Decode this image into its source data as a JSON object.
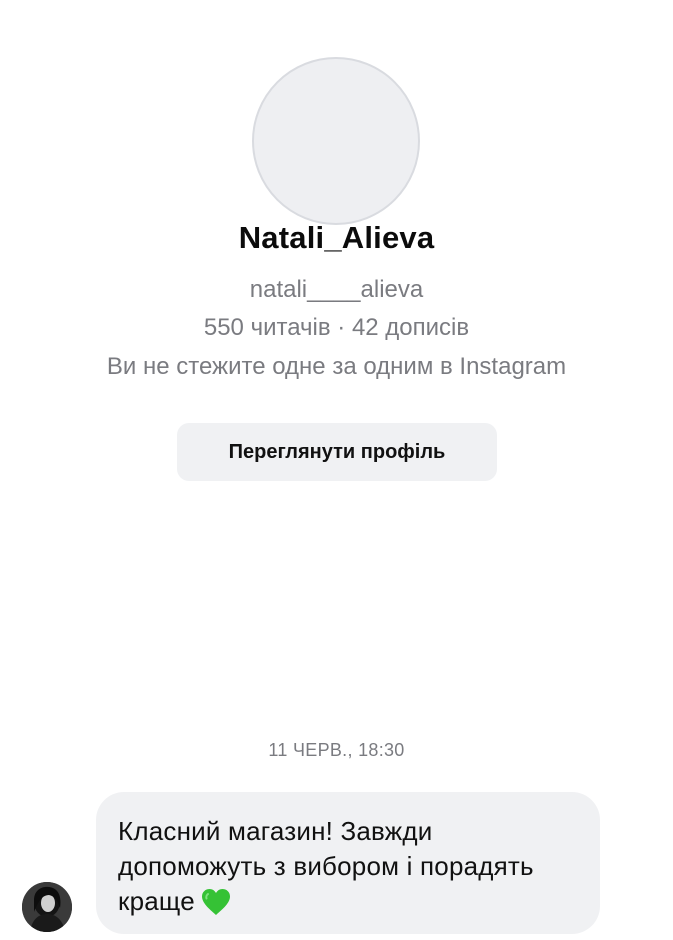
{
  "profile": {
    "display_name": "Natali_Alieva",
    "username": "natali____alieva",
    "stats": "550 читачів · 42 дописів",
    "follow_note": "Ви не стежите одне за одним в Instagram",
    "view_profile_label": "Переглянути профіль"
  },
  "thread": {
    "timestamp": "11 ЧЕРВ., 18:30",
    "message": {
      "text": "Класний магазин! Завжди допоможуть з вибором і порадять краще",
      "emoji": "green-heart-icon",
      "emoji_color": "#35c235"
    }
  },
  "colors": {
    "secondary_text": "#7a7b80",
    "bubble_bg": "#f0f1f3",
    "button_bg": "#f0f1f3",
    "avatar_placeholder": "#eeeff2"
  }
}
